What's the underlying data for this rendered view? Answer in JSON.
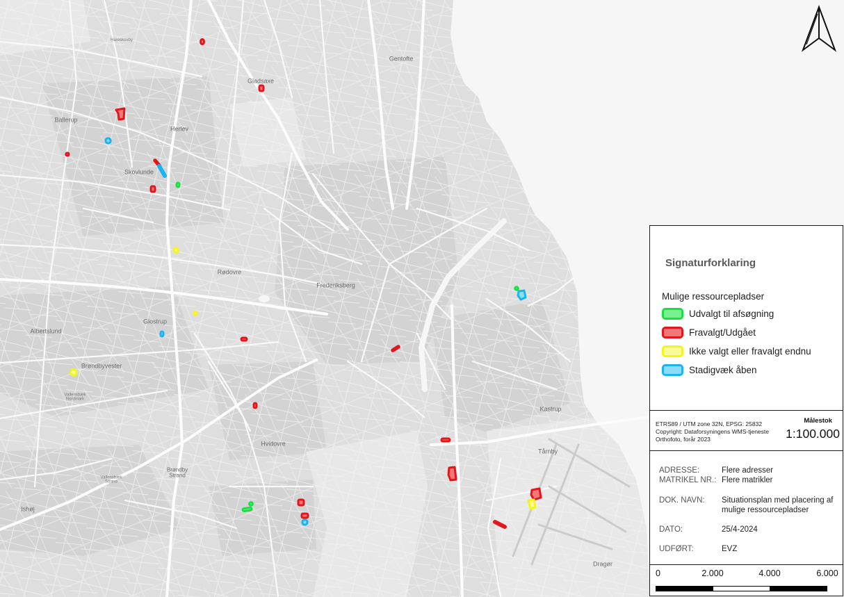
{
  "map": {
    "land_color": "#dedede",
    "sea_color": "#f6f6f6",
    "north_arrow": "north-arrow-icon",
    "places": [
      "Gentofte",
      "Gladsaxe",
      "Hareskovby",
      "Herlev",
      "Ballerup",
      "Skovlunde",
      "Rødovre",
      "Frederiksberg",
      "Glostrup",
      "Albertslund",
      "Brøndbyvester",
      "Vallensbæk Nordmark",
      "Hvidovre",
      "Brøndby Strand",
      "Vallensbæk Strand",
      "Ishøj",
      "Kastrup",
      "Tårnby",
      "Dragør"
    ]
  },
  "legend": {
    "title": "Signaturforklaring",
    "subtitle": "Mulige ressourcepladser",
    "items": [
      {
        "label": "Udvalgt til afsøgning",
        "stroke": "#19e043",
        "fill": "#79f18f"
      },
      {
        "label": "Fravalgt/Udgået",
        "stroke": "#e3161d",
        "fill": "#f07878"
      },
      {
        "label": "Ikke valgt eller fravalgt endnu",
        "stroke": "#f4f41e",
        "fill": "#fbfb9e"
      },
      {
        "label": "Stadigvæk åben",
        "stroke": "#1ab4ee",
        "fill": "#8cdcf7"
      }
    ]
  },
  "projection": {
    "crs": "ETRS89 / UTM zone 32N, EPSG: 25832",
    "copyright": "Copyright: Dataforsyningens WMS-tjeneste",
    "basemap": "Orthofoto, forår 2023"
  },
  "scale": {
    "label": "Målestok",
    "value": "1:100.000",
    "bar_labels": [
      "0",
      "2.000",
      "4.000",
      "6.000"
    ]
  },
  "info": [
    {
      "key": "ADRESSE:",
      "value": "Flere adresser"
    },
    {
      "key": "MATRIKEL NR.:",
      "value": "Flere matrikler"
    },
    {
      "key": "DOK. NAVN:",
      "value": "Situationsplan med placering af mulige ressourcepladser"
    },
    {
      "key": "DATO:",
      "value": "25/4-2024"
    },
    {
      "key": "UDFØRT:",
      "value": "EVZ"
    }
  ]
}
